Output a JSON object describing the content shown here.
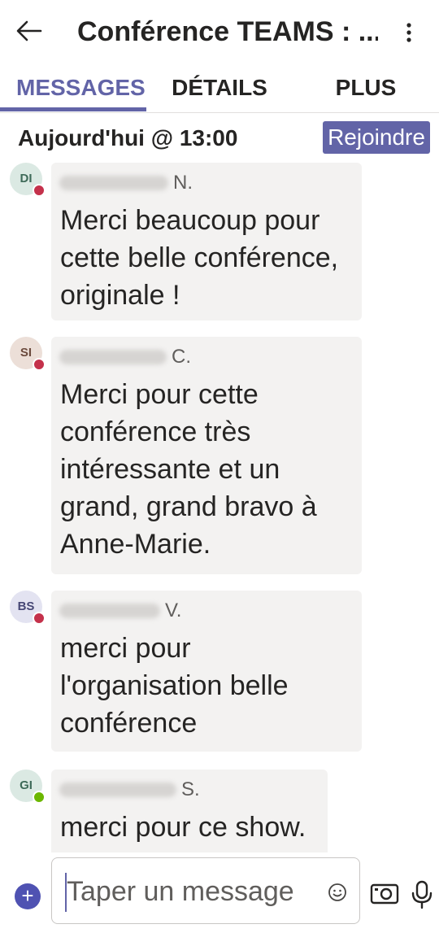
{
  "header": {
    "back_icon": "arrow-left-icon",
    "title": "Conférence TEAMS : ...",
    "more_icon": "more-vertical-icon"
  },
  "tabs": [
    {
      "label": "MESSAGES",
      "active": true
    },
    {
      "label": "DÉTAILS",
      "active": false
    },
    {
      "label": "PLUS",
      "active": false
    }
  ],
  "meeting": {
    "time_label": "Aujourd'hui @ 13:00",
    "join_label": "Rejoindre"
  },
  "messages": [
    {
      "initials": "DI",
      "avatar_bg": "#dbe9e3",
      "avatar_fg": "#3e6a58",
      "presence": "busy",
      "presence_color": "#c4314b",
      "sender_initial": "N.",
      "text": "Merci beaucoup pour\ncette belle conférence,\noriginale !"
    },
    {
      "initials": "SI",
      "avatar_bg": "#ecdfd8",
      "avatar_fg": "#6b4a3d",
      "presence": "busy",
      "presence_color": "#c4314b",
      "sender_initial": "C.",
      "text": "Merci pour cette\nconférence très\nintéressante et un\ngrand, grand bravo à\nAnne-Marie."
    },
    {
      "initials": "BS",
      "avatar_bg": "#e3e3f1",
      "avatar_fg": "#464775",
      "presence": "busy",
      "presence_color": "#c4314b",
      "sender_initial": "V.",
      "text": "merci pour\nl'organisation belle\nconférence"
    },
    {
      "initials": "GI",
      "avatar_bg": "#dbe9e3",
      "avatar_fg": "#3e6a58",
      "presence": "available",
      "presence_color": "#6bb700",
      "sender_initial": "S.",
      "text": "merci pour ce show."
    }
  ],
  "composer": {
    "add_icon": "plus-icon",
    "placeholder": "Taper un message",
    "emoji_icon": "emoji-icon",
    "camera_icon": "camera-icon",
    "mic_icon": "microphone-icon"
  },
  "colors": {
    "accent": "#6264a7",
    "bubble": "#f3f2f1"
  }
}
